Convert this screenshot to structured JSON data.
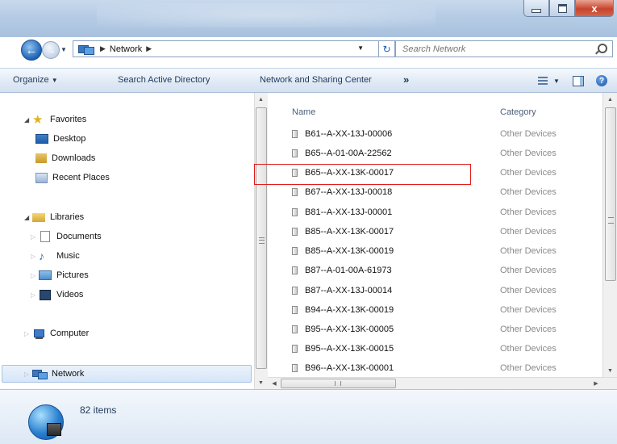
{
  "window": {
    "minimize_label": "",
    "maximize_label": "",
    "close_label": "x"
  },
  "address_bar": {
    "location": "Network",
    "search_placeholder": "Search Network"
  },
  "toolbar": {
    "organize": "Organize",
    "search_ad": "Search Active Directory",
    "network_sharing": "Network and Sharing Center",
    "more": "»"
  },
  "nav": {
    "favorites": "Favorites",
    "desktop": "Desktop",
    "downloads": "Downloads",
    "recent_places": "Recent Places",
    "libraries": "Libraries",
    "documents": "Documents",
    "music": "Music",
    "pictures": "Pictures",
    "videos": "Videos",
    "computer": "Computer",
    "network": "Network"
  },
  "columns": {
    "name": "Name",
    "category": "Category"
  },
  "files": [
    {
      "name": "B61--A-XX-13J-00006",
      "category": "Other Devices"
    },
    {
      "name": "B65--A-01-00A-22562",
      "category": "Other Devices"
    },
    {
      "name": "B65--A-XX-13K-00017",
      "category": "Other Devices"
    },
    {
      "name": "B67--A-XX-13J-00018",
      "category": "Other Devices"
    },
    {
      "name": "B81--A-XX-13J-00001",
      "category": "Other Devices"
    },
    {
      "name": "B85--A-XX-13K-00017",
      "category": "Other Devices"
    },
    {
      "name": "B85--A-XX-13K-00019",
      "category": "Other Devices"
    },
    {
      "name": "B87--A-01-00A-61973",
      "category": "Other Devices"
    },
    {
      "name": "B87--A-XX-13J-00014",
      "category": "Other Devices"
    },
    {
      "name": "B94--A-XX-13K-00019",
      "category": "Other Devices"
    },
    {
      "name": "B95--A-XX-13K-00005",
      "category": "Other Devices"
    },
    {
      "name": "B95--A-XX-13K-00015",
      "category": "Other Devices"
    },
    {
      "name": "B96--A-XX-13K-00001",
      "category": "Other Devices"
    }
  ],
  "status": {
    "item_count": "82 items"
  }
}
